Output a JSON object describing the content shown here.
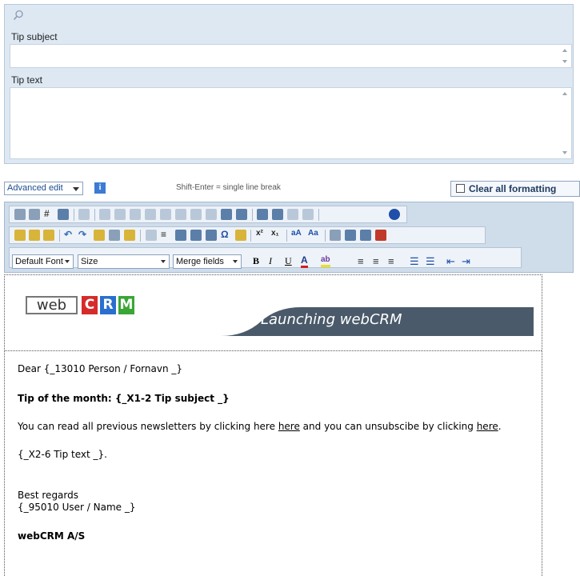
{
  "form": {
    "subject_label": "Tip subject",
    "subject_value": "",
    "text_label": "Tip text",
    "text_value": ""
  },
  "editor_bar": {
    "mode_value": "Advanced edit",
    "hint": "Shift-Enter = single line break",
    "clear_formatting_label": "Clear all formatting"
  },
  "toolbar": {
    "font_value": "Default Font",
    "size_value": "Size",
    "merge_value": "Merge fields",
    "bold": "B",
    "italic": "I",
    "underline": "U",
    "font_color": "A",
    "highlight": "ab"
  },
  "banner": {
    "logo_web": "web",
    "logo_c": "C",
    "logo_r": "R",
    "logo_m": "M",
    "title": "Launching webCRM",
    "colors": {
      "c": "#d62b2b",
      "r": "#2a6fcf",
      "m": "#3aa635",
      "bar": "#4a5a6a"
    }
  },
  "content": {
    "greeting": "Dear {_13010 Person / Fornavn _}",
    "tip_heading": "Tip of the month: {_X1-2 Tip subject _}",
    "newsletter_pre": "You can read all previous newsletters by clicking here ",
    "newsletter_link1": "here",
    "newsletter_mid": " and you can unsubscibe by clicking ",
    "newsletter_link2": "here",
    "newsletter_end": ".",
    "tip_text": "{_X2-6 Tip text _}.",
    "regards": "Best regards",
    "user_name": "{_95010 User / Name _}",
    "company": "webCRM A/S"
  }
}
